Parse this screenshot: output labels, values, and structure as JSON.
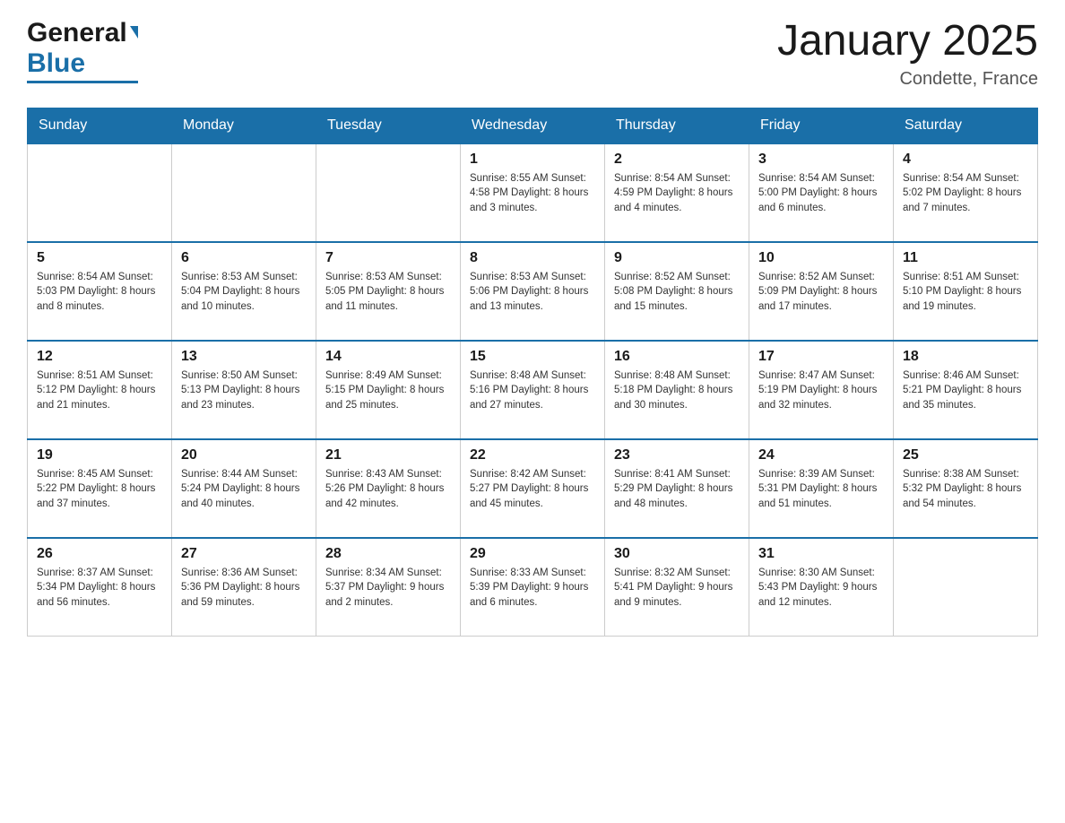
{
  "header": {
    "logo_general": "General",
    "logo_blue": "Blue",
    "title": "January 2025",
    "location": "Condette, France"
  },
  "days_of_week": [
    "Sunday",
    "Monday",
    "Tuesday",
    "Wednesday",
    "Thursday",
    "Friday",
    "Saturday"
  ],
  "weeks": [
    [
      {
        "day": "",
        "info": ""
      },
      {
        "day": "",
        "info": ""
      },
      {
        "day": "",
        "info": ""
      },
      {
        "day": "1",
        "info": "Sunrise: 8:55 AM\nSunset: 4:58 PM\nDaylight: 8 hours\nand 3 minutes."
      },
      {
        "day": "2",
        "info": "Sunrise: 8:54 AM\nSunset: 4:59 PM\nDaylight: 8 hours\nand 4 minutes."
      },
      {
        "day": "3",
        "info": "Sunrise: 8:54 AM\nSunset: 5:00 PM\nDaylight: 8 hours\nand 6 minutes."
      },
      {
        "day": "4",
        "info": "Sunrise: 8:54 AM\nSunset: 5:02 PM\nDaylight: 8 hours\nand 7 minutes."
      }
    ],
    [
      {
        "day": "5",
        "info": "Sunrise: 8:54 AM\nSunset: 5:03 PM\nDaylight: 8 hours\nand 8 minutes."
      },
      {
        "day": "6",
        "info": "Sunrise: 8:53 AM\nSunset: 5:04 PM\nDaylight: 8 hours\nand 10 minutes."
      },
      {
        "day": "7",
        "info": "Sunrise: 8:53 AM\nSunset: 5:05 PM\nDaylight: 8 hours\nand 11 minutes."
      },
      {
        "day": "8",
        "info": "Sunrise: 8:53 AM\nSunset: 5:06 PM\nDaylight: 8 hours\nand 13 minutes."
      },
      {
        "day": "9",
        "info": "Sunrise: 8:52 AM\nSunset: 5:08 PM\nDaylight: 8 hours\nand 15 minutes."
      },
      {
        "day": "10",
        "info": "Sunrise: 8:52 AM\nSunset: 5:09 PM\nDaylight: 8 hours\nand 17 minutes."
      },
      {
        "day": "11",
        "info": "Sunrise: 8:51 AM\nSunset: 5:10 PM\nDaylight: 8 hours\nand 19 minutes."
      }
    ],
    [
      {
        "day": "12",
        "info": "Sunrise: 8:51 AM\nSunset: 5:12 PM\nDaylight: 8 hours\nand 21 minutes."
      },
      {
        "day": "13",
        "info": "Sunrise: 8:50 AM\nSunset: 5:13 PM\nDaylight: 8 hours\nand 23 minutes."
      },
      {
        "day": "14",
        "info": "Sunrise: 8:49 AM\nSunset: 5:15 PM\nDaylight: 8 hours\nand 25 minutes."
      },
      {
        "day": "15",
        "info": "Sunrise: 8:48 AM\nSunset: 5:16 PM\nDaylight: 8 hours\nand 27 minutes."
      },
      {
        "day": "16",
        "info": "Sunrise: 8:48 AM\nSunset: 5:18 PM\nDaylight: 8 hours\nand 30 minutes."
      },
      {
        "day": "17",
        "info": "Sunrise: 8:47 AM\nSunset: 5:19 PM\nDaylight: 8 hours\nand 32 minutes."
      },
      {
        "day": "18",
        "info": "Sunrise: 8:46 AM\nSunset: 5:21 PM\nDaylight: 8 hours\nand 35 minutes."
      }
    ],
    [
      {
        "day": "19",
        "info": "Sunrise: 8:45 AM\nSunset: 5:22 PM\nDaylight: 8 hours\nand 37 minutes."
      },
      {
        "day": "20",
        "info": "Sunrise: 8:44 AM\nSunset: 5:24 PM\nDaylight: 8 hours\nand 40 minutes."
      },
      {
        "day": "21",
        "info": "Sunrise: 8:43 AM\nSunset: 5:26 PM\nDaylight: 8 hours\nand 42 minutes."
      },
      {
        "day": "22",
        "info": "Sunrise: 8:42 AM\nSunset: 5:27 PM\nDaylight: 8 hours\nand 45 minutes."
      },
      {
        "day": "23",
        "info": "Sunrise: 8:41 AM\nSunset: 5:29 PM\nDaylight: 8 hours\nand 48 minutes."
      },
      {
        "day": "24",
        "info": "Sunrise: 8:39 AM\nSunset: 5:31 PM\nDaylight: 8 hours\nand 51 minutes."
      },
      {
        "day": "25",
        "info": "Sunrise: 8:38 AM\nSunset: 5:32 PM\nDaylight: 8 hours\nand 54 minutes."
      }
    ],
    [
      {
        "day": "26",
        "info": "Sunrise: 8:37 AM\nSunset: 5:34 PM\nDaylight: 8 hours\nand 56 minutes."
      },
      {
        "day": "27",
        "info": "Sunrise: 8:36 AM\nSunset: 5:36 PM\nDaylight: 8 hours\nand 59 minutes."
      },
      {
        "day": "28",
        "info": "Sunrise: 8:34 AM\nSunset: 5:37 PM\nDaylight: 9 hours\nand 2 minutes."
      },
      {
        "day": "29",
        "info": "Sunrise: 8:33 AM\nSunset: 5:39 PM\nDaylight: 9 hours\nand 6 minutes."
      },
      {
        "day": "30",
        "info": "Sunrise: 8:32 AM\nSunset: 5:41 PM\nDaylight: 9 hours\nand 9 minutes."
      },
      {
        "day": "31",
        "info": "Sunrise: 8:30 AM\nSunset: 5:43 PM\nDaylight: 9 hours\nand 12 minutes."
      },
      {
        "day": "",
        "info": ""
      }
    ]
  ]
}
